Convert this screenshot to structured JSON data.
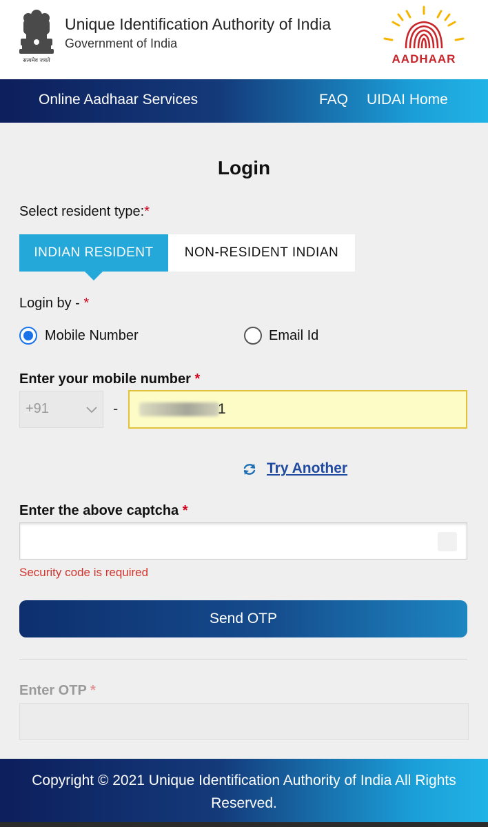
{
  "header": {
    "org_name": "Unique Identification Authority of India",
    "gov_name": "Government of India",
    "emblem_motto": "सत्यमेव जयते",
    "logo_text": "AADHAAR"
  },
  "nav": {
    "title": "Online Aadhaar Services",
    "faq": "FAQ",
    "home": "UIDAI Home"
  },
  "login": {
    "title": "Login",
    "resident_type_label": "Select resident type:",
    "resident_tabs": [
      {
        "label": "INDIAN RESIDENT",
        "active": true
      },
      {
        "label": "NON-RESIDENT INDIAN",
        "active": false
      }
    ],
    "login_by_label": "Login by - ",
    "login_by_options": [
      {
        "label": "Mobile Number",
        "selected": true
      },
      {
        "label": "Email Id",
        "selected": false
      }
    ],
    "mobile_label": "Enter your mobile number ",
    "country_code": "+91",
    "dash": "-",
    "mobile_value_visible": "1",
    "try_another": "Try Another",
    "captcha_label": "Enter the above captcha ",
    "captcha_value": "",
    "captcha_error": "Security code is required",
    "send_otp": "Send OTP",
    "otp_label": "Enter OTP ",
    "otp_value": "",
    "required_marker": "*"
  },
  "footer": {
    "copyright": "Copyright © 2021 Unique Identification Authority of India All Rights Reserved."
  },
  "colors": {
    "accent_tab": "#23a8d9",
    "required": "#d0021b",
    "error": "#d0342c",
    "link": "#1f4aa0",
    "radio": "#1a73e8",
    "autofill_bg": "#fdfcc6",
    "nav_gradient_start": "#0d1f5c",
    "nav_gradient_end": "#21b3e6"
  },
  "icons": {
    "emblem": "national-emblem-icon",
    "logo": "aadhaar-logo-icon",
    "refresh": "refresh-icon",
    "dropdown": "chevron-down-icon"
  }
}
